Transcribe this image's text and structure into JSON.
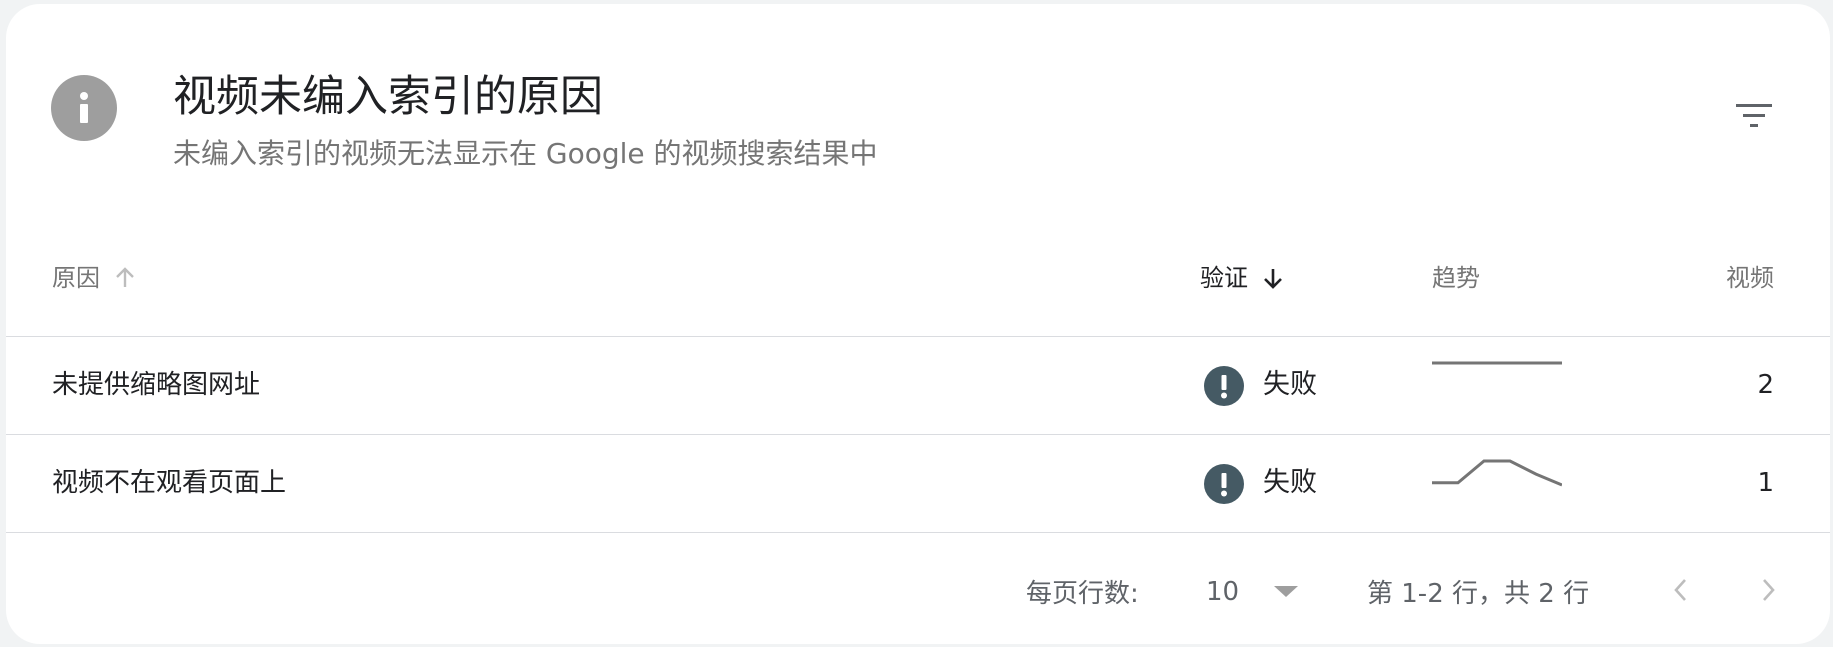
{
  "header": {
    "title": "视频未编入索引的原因",
    "subtitle": "未编入索引的视频无法显示在 Google 的视频搜索结果中"
  },
  "table": {
    "columns": {
      "reason": "原因",
      "verification": "验证",
      "trend": "趋势",
      "videos": "视频"
    },
    "rows": [
      {
        "reason": "未提供缩略图网址",
        "status": "失败",
        "count": "2",
        "trend": [
          2,
          2,
          2,
          2,
          2,
          2
        ]
      },
      {
        "reason": "视频不在观看页面上",
        "status": "失败",
        "count": "1",
        "trend": [
          1,
          1,
          2,
          2,
          1.4,
          0.9
        ]
      }
    ]
  },
  "footer": {
    "rows_per_page_label": "每页行数:",
    "rows_per_page_value": "10",
    "range_text": "第 1-2 行，共 2 行"
  },
  "colors": {
    "status_fail": "#455a64",
    "info_icon": "#9e9e9e",
    "trend_line": "#757575"
  }
}
